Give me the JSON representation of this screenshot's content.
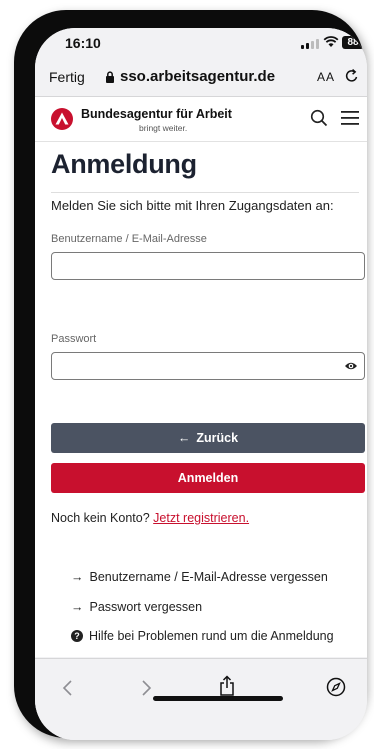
{
  "status": {
    "time": "16:10",
    "battery": "88"
  },
  "browser": {
    "done_label": "Fertig",
    "url": "sso.arbeitsagentur.de",
    "text_size_label": "AA"
  },
  "site": {
    "brand_name": "Bundesagentur für Arbeit",
    "brand_tagline": "bringt weiter.",
    "brand_color": "#c8102e"
  },
  "login": {
    "title": "Anmeldung",
    "intro": "Melden Sie sich bitte mit Ihren Zugangsdaten an:",
    "username_label": "Benutzername / E-Mail-Adresse",
    "username_value": "",
    "password_label": "Passwort",
    "password_value": "",
    "back_label": "Zurück",
    "login_label": "Anmelden",
    "no_account_text": "Noch kein Konto?",
    "register_link": "Jetzt registrieren.",
    "forgot_username": "Benutzername / E-Mail-Adresse vergessen",
    "forgot_password": "Passwort vergessen",
    "help": "Hilfe bei Problemen rund um die Anmeldung"
  },
  "colors": {
    "back_button": "#4b5362",
    "login_button": "#c8102e",
    "link": "#c8102e"
  },
  "icons": [
    "lock-icon",
    "reload-icon",
    "search-icon",
    "menu-icon",
    "eye-icon",
    "arrow-left-icon",
    "arrow-right-icon",
    "question-icon",
    "back-icon",
    "forward-icon",
    "share-icon",
    "compass-icon"
  ]
}
